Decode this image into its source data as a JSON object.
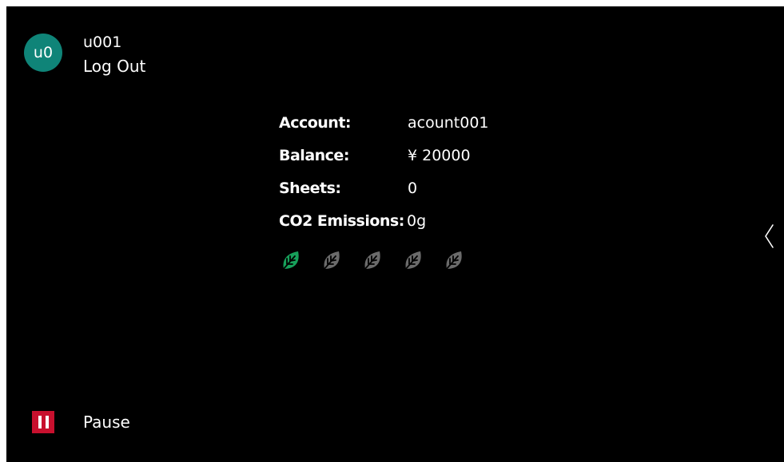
{
  "user": {
    "avatar_initials": "u0",
    "id": "u001",
    "logout_label": "Log Out"
  },
  "account": {
    "rows": [
      {
        "label": "Account:",
        "value": "acount001"
      },
      {
        "label": "Balance:",
        "value": "¥ 20000"
      },
      {
        "label": "Sheets:",
        "value": "0"
      },
      {
        "label": "CO2 Emissions:",
        "value": "0g"
      }
    ]
  },
  "eco_rating": {
    "level": 1,
    "max": 5,
    "active_color": "#17a05a",
    "inactive_color": "#6b6b6b",
    "icon": "leaf-icon"
  },
  "navigation": {
    "side_panel_icon": "chevron-left-icon"
  },
  "footer": {
    "pause_label": "Pause",
    "pause_color": "#c8102e",
    "pause_icon": "pause-icon"
  },
  "colors": {
    "background": "#000000",
    "avatar": "#0f8478",
    "text": "#ffffff"
  }
}
